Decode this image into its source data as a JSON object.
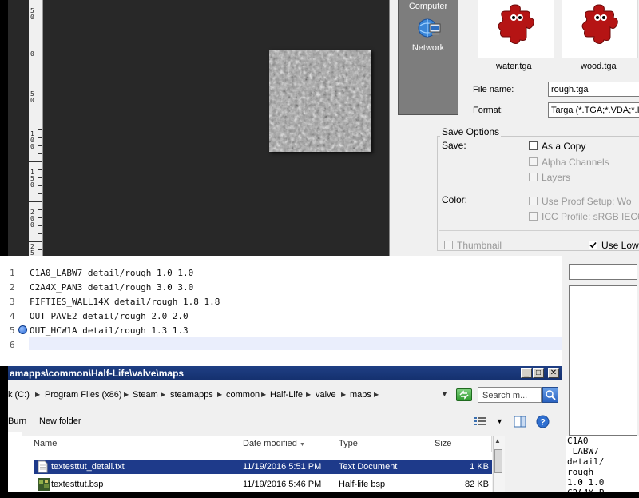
{
  "ruler": {
    "labels": [
      "50",
      "0",
      "50",
      "100",
      "150",
      "200",
      "250"
    ]
  },
  "save_dialog": {
    "places": [
      {
        "label": "Computer",
        "icon": "computer-icon"
      },
      {
        "label": "Network",
        "icon": "network-icon"
      }
    ],
    "thumbnails": [
      {
        "label": "water.tga",
        "icon": "puzzle-file-icon"
      },
      {
        "label": "wood.tga",
        "icon": "puzzle-file-icon"
      }
    ],
    "file_name_label": "File name:",
    "file_name_value": "rough.tga",
    "format_label": "Format:",
    "format_value": "Targa (*.TGA;*.VDA;*.IC",
    "save_options_title": "Save Options",
    "save_label": "Save:",
    "as_copy": "As a Copy",
    "alpha_channels": "Alpha Channels",
    "layers": "Layers",
    "color_label": "Color:",
    "use_proof_setup": "Use Proof Setup:  Wo",
    "icc_profile": "ICC Profile:  sRGB IEC6",
    "thumbnail": "Thumbnail",
    "use_lower": "Use Low"
  },
  "editor": {
    "lines": [
      {
        "num": "1",
        "text": "C1A0_LABW7 detail/rough 1.0 1.0"
      },
      {
        "num": "2",
        "text": "C2A4X_PAN3 detail/rough 3.0 3.0"
      },
      {
        "num": "3",
        "text": "FIFTIES_WALL14X detail/rough 1.8 1.8"
      },
      {
        "num": "4",
        "text": "OUT_PAVE2 detail/rough 2.0 2.0"
      },
      {
        "num": "5",
        "text": "OUT_HCW1A detail/rough 1.3 1.3"
      },
      {
        "num": "6",
        "text": ""
      }
    ]
  },
  "right_panel": {
    "lines": [
      "C1A0",
      "_LABW7",
      "detail/",
      "rough",
      "1.0 1.0",
      "C2A4X_P"
    ]
  },
  "explorer": {
    "title": "amapps\\common\\Half-Life\\valve\\maps",
    "breadcrumb": [
      "k (C:)",
      "Program Files (x86)",
      "Steam",
      "steamapps",
      "common",
      "Half-Life",
      "valve",
      "maps"
    ],
    "search_placeholder": "Search m...",
    "toolbar": {
      "burn": "Burn",
      "new_folder": "New folder"
    },
    "columns": {
      "name": "Name",
      "date": "Date modified",
      "type": "Type",
      "size": "Size"
    },
    "files": [
      {
        "name": "textesttut_detail.txt",
        "date": "11/19/2016 5:51 PM",
        "type": "Text Document",
        "size": "1 KB",
        "icon": "text-file-icon"
      },
      {
        "name": "textesttut.bsp",
        "date": "11/19/2016 5:46 PM",
        "type": "Half-life bsp",
        "size": "82 KB",
        "icon": "bsp-file-icon"
      }
    ]
  },
  "colors": {
    "canvas_bg": "#282828",
    "title_bar": "#1f3f84",
    "selection": "#1e3a8a",
    "puzzle_red": "#b51414"
  }
}
